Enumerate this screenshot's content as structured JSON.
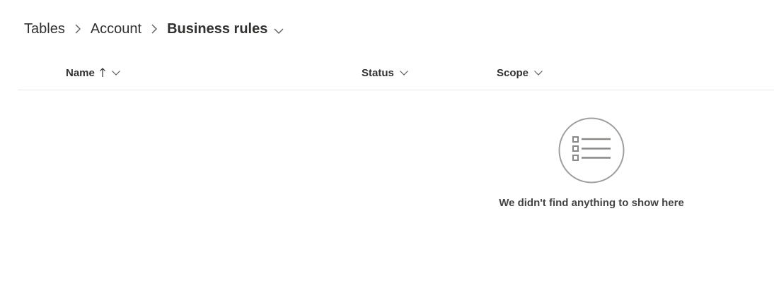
{
  "breadcrumb": {
    "items": [
      {
        "label": "Tables"
      },
      {
        "label": "Account"
      }
    ],
    "current": "Business rules"
  },
  "grid": {
    "columns": [
      {
        "label": "Name",
        "sorted": "ascending"
      },
      {
        "label": "Status"
      },
      {
        "label": "Scope"
      }
    ],
    "rows": []
  },
  "empty_state": {
    "icon": "list-icon",
    "message": "We didn't find anything to show here"
  }
}
